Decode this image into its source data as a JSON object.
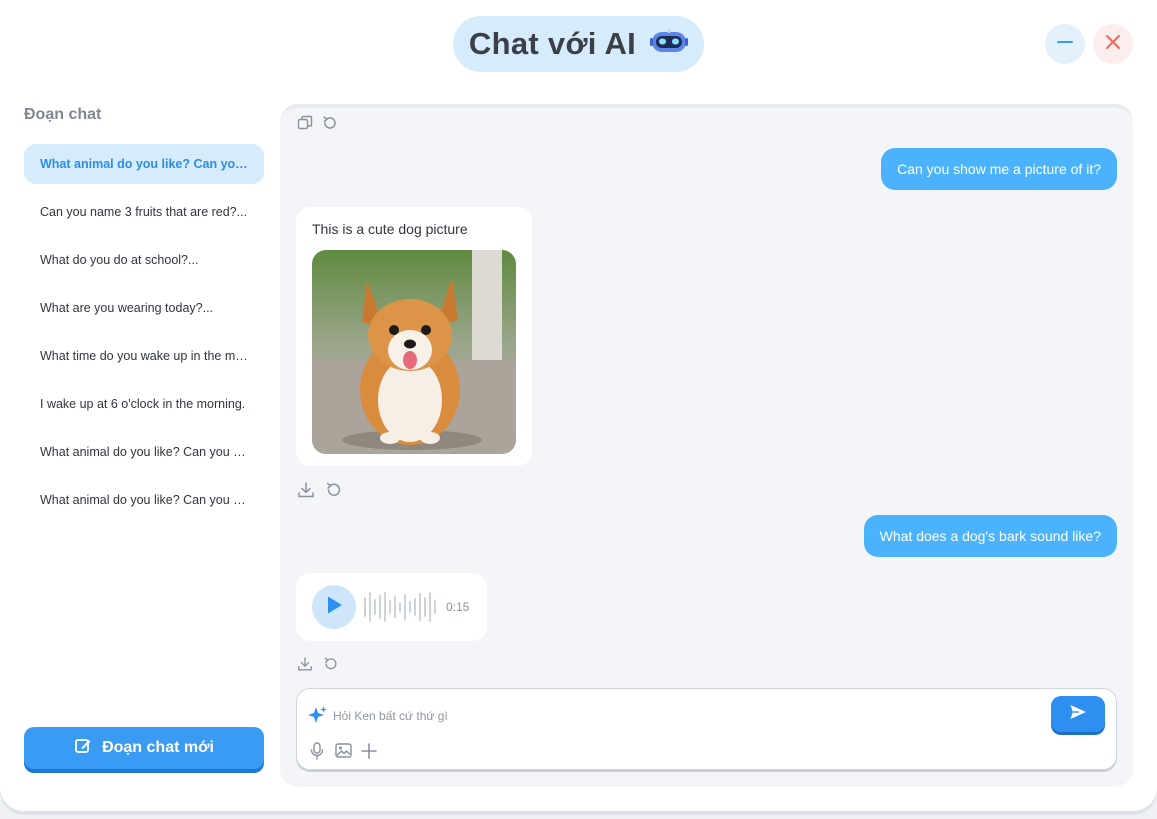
{
  "header": {
    "title": "Chat với AI",
    "icons": {
      "robot": "robot-mascot-icon",
      "minimize": "minimize-icon",
      "close": "close-icon"
    }
  },
  "colors": {
    "accent": "#3a9bf5",
    "user_bubble": "#4bb3fb",
    "active_item_bg": "#d6ebfb",
    "close_red": "#f06a5a"
  },
  "sidebar": {
    "title": "Đoạn chat",
    "items": [
      {
        "label": "What animal do you like? Can you...",
        "active": true
      },
      {
        "label": "Can you name 3 fruits that are red?...",
        "active": false
      },
      {
        "label": "What do you do at school?...",
        "active": false
      },
      {
        "label": "What are you wearing today?...",
        "active": false
      },
      {
        "label": "What time do you wake up in the mo...",
        "active": false
      },
      {
        "label": "I wake up at 6 o'clock in the morning.",
        "active": false
      },
      {
        "label": "What animal do you like? Can you de...",
        "active": false
      },
      {
        "label": "What animal do you like? Can you de...",
        "active": false
      }
    ],
    "new_chat_label": "Đoạn chat mới"
  },
  "messages": {
    "user_1": "Can you show me a picture of it?",
    "ai_1_text": "This is a cute dog picture",
    "ai_1_image": "corgi-puppy-photo",
    "user_2": "What does a dog's bark sound like?",
    "ai_2_audio_duration": "0:15"
  },
  "composer": {
    "placeholder": "Hỏi Ken bất cứ thứ gì",
    "value": ""
  }
}
